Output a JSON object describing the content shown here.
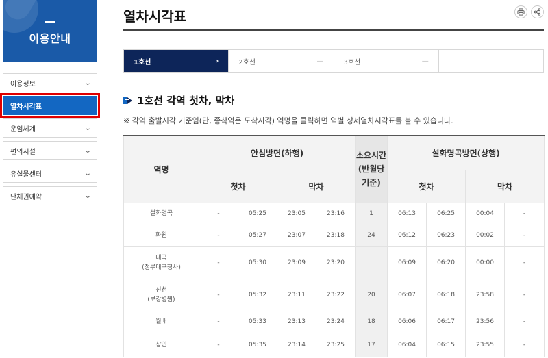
{
  "sidebar": {
    "banner_title": "이용안내",
    "items": [
      {
        "label": "이용정보",
        "active": false
      },
      {
        "label": "열차시각표",
        "active": true
      },
      {
        "label": "운임체계",
        "active": false
      },
      {
        "label": "편의시설",
        "active": false
      },
      {
        "label": "유실물센터",
        "active": false
      },
      {
        "label": "단체권예약",
        "active": false
      }
    ],
    "highlight_color": "#e00000",
    "active_color": "#1367c2"
  },
  "page": {
    "title": "열차시각표",
    "tools": [
      {
        "icon": "print-icon"
      },
      {
        "icon": "share-icon"
      }
    ]
  },
  "tabs": [
    {
      "label": "1호선",
      "active": true,
      "mark": "›"
    },
    {
      "label": "2호선",
      "active": false,
      "mark": "—"
    },
    {
      "label": "3호선",
      "active": false,
      "mark": "—"
    },
    {
      "label": "",
      "active": false,
      "mark": ""
    }
  ],
  "section": {
    "title": "1호선 각역 첫차, 막차",
    "notice": "※ 각역 출발시각 기준임(단, 종착역은 도착시각) 역명을 클릭하면 역별 상세열차시각표를 볼 수 있습니다."
  },
  "table": {
    "headers": {
      "station": "역명",
      "down": "안심방면(하행)",
      "duration": "소요시간(반월당기준)",
      "up": "설화명곡방면(상행)",
      "first": "첫차",
      "last": "막차"
    },
    "rows": [
      {
        "name": "설화명곡",
        "sub": "",
        "d": [
          "-",
          "05:25",
          "23:05",
          "23:16"
        ],
        "dur": "1",
        "u": [
          "06:13",
          "06:25",
          "00:04",
          "-"
        ]
      },
      {
        "name": "화원",
        "sub": "",
        "d": [
          "-",
          "05:27",
          "23:07",
          "23:18"
        ],
        "dur": "24",
        "u": [
          "06:12",
          "06:23",
          "00:02",
          "-"
        ]
      },
      {
        "name": "대곡",
        "sub": "(정부대구청사)",
        "d": [
          "-",
          "05:30",
          "23:09",
          "23:20"
        ],
        "dur": "",
        "u": [
          "06:09",
          "06:20",
          "00:00",
          "-"
        ]
      },
      {
        "name": "진천",
        "sub": "(보강병원)",
        "d": [
          "-",
          "05:32",
          "23:11",
          "23:22"
        ],
        "dur": "20",
        "u": [
          "06:07",
          "06:18",
          "23:58",
          "-"
        ]
      },
      {
        "name": "월배",
        "sub": "",
        "d": [
          "-",
          "05:33",
          "23:13",
          "23:24"
        ],
        "dur": "18",
        "u": [
          "06:06",
          "06:17",
          "23:56",
          "-"
        ]
      },
      {
        "name": "상인",
        "sub": "",
        "d": [
          "-",
          "05:35",
          "23:14",
          "23:25"
        ],
        "dur": "17",
        "u": [
          "06:04",
          "06:15",
          "23:55",
          "-"
        ]
      }
    ]
  }
}
